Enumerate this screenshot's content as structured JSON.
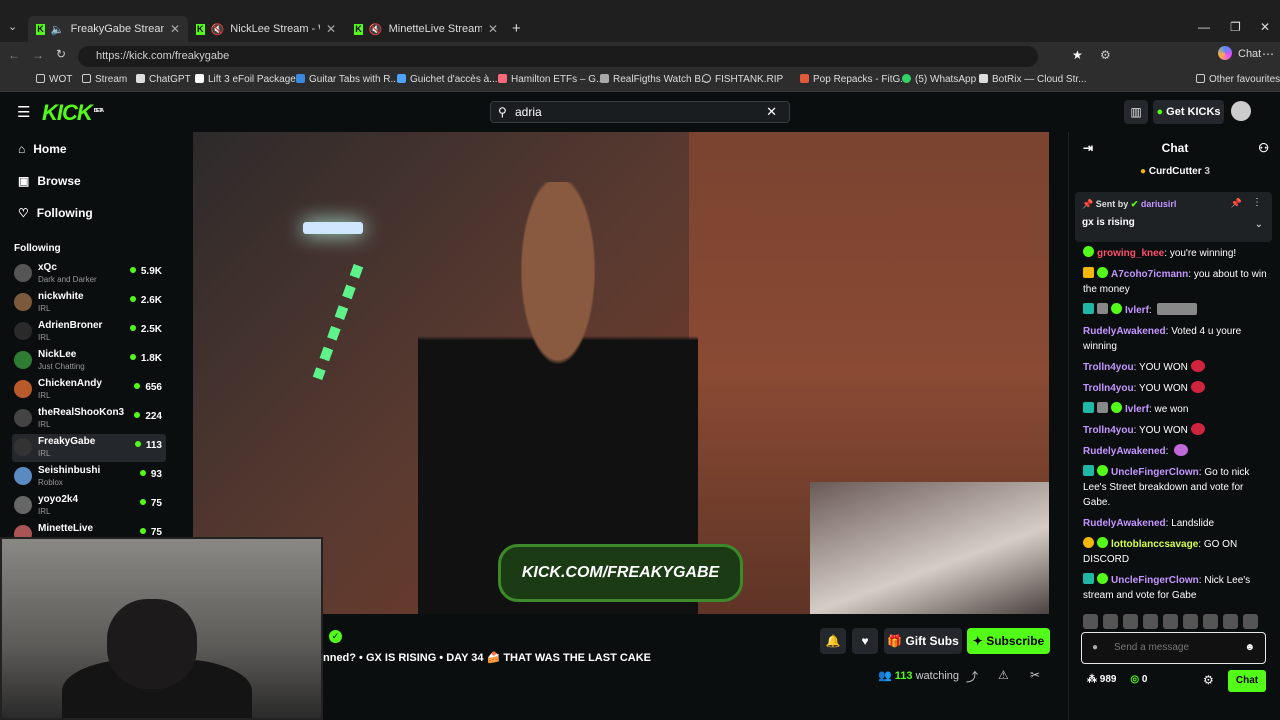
{
  "browser": {
    "tabs": [
      {
        "label": "FreakyGabe Stream - Watch L",
        "active": true
      },
      {
        "label": "NickLee Stream - Watch Live",
        "active": false
      },
      {
        "label": "MinetteLive Stream - Watch L",
        "active": false
      }
    ],
    "url": "https://kick.com/freakygabe",
    "chat_label": "Chat",
    "bookmarks": [
      "WOT",
      "Stream",
      "ChatGPT",
      "Lift 3 eFoil Package...",
      "Guitar Tabs with R...",
      "Guichet d'accès à...",
      "Hamilton ETFs – G...",
      "RealFigths Watch B...",
      "FISHTANK.RIP",
      "Pop Repacks - FitG...",
      "(5) WhatsApp",
      "BotRix — Cloud Str...",
      "Other favourites"
    ]
  },
  "kick": {
    "logo": "KICK",
    "logo_badge": "BETA",
    "search_value": "adria",
    "get_kicks": "Get KICKs"
  },
  "sidebar": {
    "nav": [
      "Home",
      "Browse",
      "Following"
    ],
    "following_header": "Following",
    "channels": [
      {
        "name": "xQc",
        "cat": "Dark and Darker",
        "count": "5.9K"
      },
      {
        "name": "nickwhite",
        "cat": "IRL",
        "count": "2.6K"
      },
      {
        "name": "AdrienBroner",
        "cat": "IRL",
        "count": "2.5K"
      },
      {
        "name": "NickLee",
        "cat": "Just Chatting",
        "count": "1.8K"
      },
      {
        "name": "ChickenAndy",
        "cat": "IRL",
        "count": "656"
      },
      {
        "name": "theRealShooKon3",
        "cat": "IRL",
        "count": "224"
      },
      {
        "name": "FreakyGabe",
        "cat": "IRL",
        "count": "113"
      },
      {
        "name": "Seishinbushi",
        "cat": "Roblox",
        "count": "93"
      },
      {
        "name": "yoyo2k4",
        "cat": "IRL",
        "count": "75"
      },
      {
        "name": "MinetteLive",
        "cat": "",
        "count": "75"
      }
    ]
  },
  "video": {
    "banner": "KICK.COM/FREAKYGABE"
  },
  "stream": {
    "title": "nned? • GX IS RISING • DAY 34 🍰 THAT WAS THE LAST CAKE",
    "gift_subs": "Gift Subs",
    "subscribe": "Subscribe",
    "watching_count": "113",
    "watching_label": "watching"
  },
  "chat": {
    "header": "Chat",
    "top_gifter": "CurdCutter",
    "top_gifter_count": "3",
    "pinned_by_label": "Sent by",
    "pinned_by": "dariusirl",
    "pinned_text": "gx is rising",
    "messages": [
      {
        "user": "growing_knee",
        "color": "#ff4d6d",
        "text": "you're winning!"
      },
      {
        "user": "A7coho7icmann",
        "color": "#c596ff",
        "text": "you about to win the money"
      },
      {
        "user": "Ivlerf",
        "color": "#c596ff",
        "text": ""
      },
      {
        "user": "RudelyAwakened",
        "color": "#c596ff",
        "text": "Voted 4 u youre winning"
      },
      {
        "user": "Trolln4you",
        "color": "#c596ff",
        "text": "YOU WON"
      },
      {
        "user": "Trolln4you",
        "color": "#c596ff",
        "text": "YOU WON"
      },
      {
        "user": "Ivlerf",
        "color": "#c596ff",
        "text": "we won"
      },
      {
        "user": "Trolln4you",
        "color": "#c596ff",
        "text": "YOU WON"
      },
      {
        "user": "RudelyAwakened",
        "color": "#c596ff",
        "text": ""
      },
      {
        "user": "UncleFingerClown",
        "color": "#c596ff",
        "text": "Go to nick Lee's Street breakdown and vote for Gabe."
      },
      {
        "user": "RudelyAwakened",
        "color": "#c596ff",
        "text": "Landslide"
      },
      {
        "user": "lottoblanccsavage",
        "color": "#d6ff4d",
        "text": "GO ON DISCORD"
      },
      {
        "user": "UncleFingerClown",
        "color": "#c596ff",
        "text": "Nick Lee's stream and vote for Gabe"
      }
    ],
    "input_placeholder": "Send a message",
    "points": "989",
    "kicks": "0",
    "send_label": "Chat"
  },
  "colors": {
    "accent": "#53fc18",
    "bg": "#0b0e0f",
    "panel": "#24272c"
  }
}
